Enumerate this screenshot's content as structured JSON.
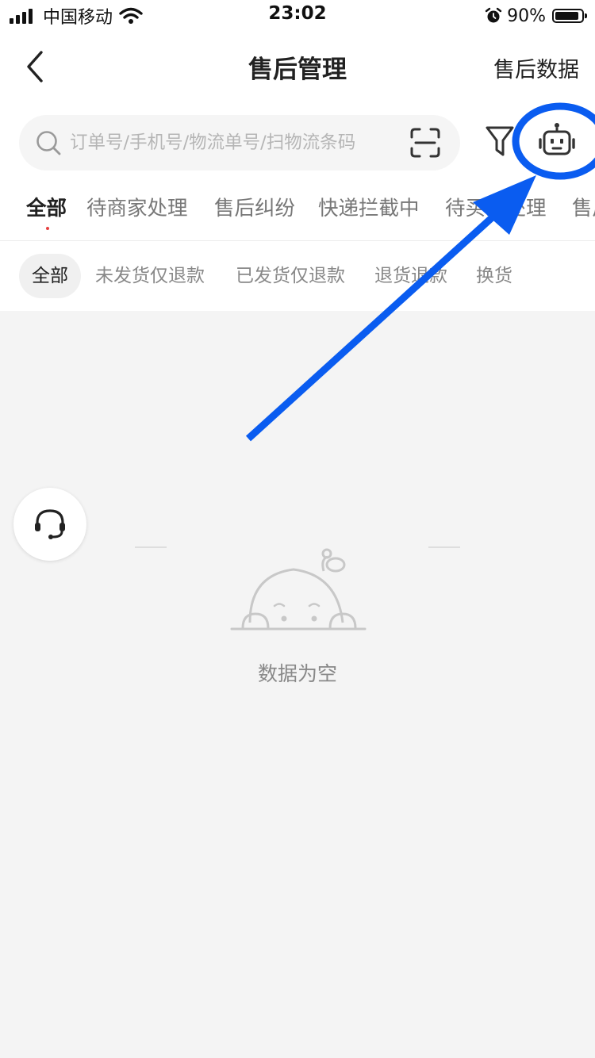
{
  "status_bar": {
    "carrier": "中国移动",
    "time": "23:02",
    "battery_pct": "90%",
    "icons": [
      "signal-icon",
      "wifi-icon",
      "alarm-icon",
      "battery-icon"
    ]
  },
  "nav": {
    "title": "售后管理",
    "right_link": "售后数据",
    "back_icon": "chevron-left-icon"
  },
  "search": {
    "placeholder": "订单号/手机号/物流单号/扫物流条码",
    "value": "",
    "icons": [
      "search-icon",
      "scan-icon",
      "filter-icon",
      "robot-icon"
    ]
  },
  "tabs": [
    {
      "label": "全部",
      "active": true
    },
    {
      "label": "待商家处理",
      "active": false
    },
    {
      "label": "售后纠纷",
      "active": false
    },
    {
      "label": "快递拦截中",
      "active": false
    },
    {
      "label": "待买家处理",
      "active": false
    },
    {
      "label": "售后",
      "active": false
    }
  ],
  "chips": [
    {
      "label": "全部",
      "active": true
    },
    {
      "label": "未发货仅退款",
      "active": false
    },
    {
      "label": "已发货仅退款",
      "active": false
    },
    {
      "label": "退货退款",
      "active": false
    },
    {
      "label": "换货",
      "active": false
    }
  ],
  "support_button_icon": "headset-icon",
  "empty_state": {
    "icon": "peeking-baby-icon",
    "text": "数据为空"
  },
  "colors": {
    "annotation_blue": "#0a5cf0",
    "active_dot": "#e64040",
    "background": "#f4f4f4"
  }
}
